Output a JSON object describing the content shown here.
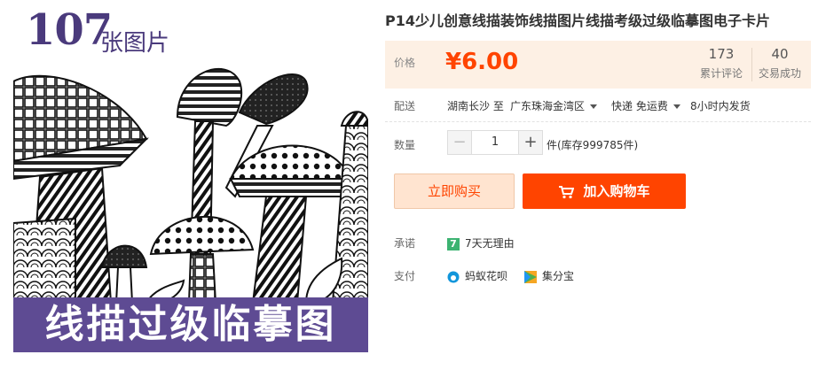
{
  "hero": {
    "count": "107",
    "count_unit": "张图片",
    "banner": "线描过级临摹图"
  },
  "product": {
    "title": "P14少儿创意线描装饰线描图片线描考级过级临摹图电子卡片"
  },
  "price": {
    "label": "价格",
    "value": "¥6.00",
    "reviews_count": "173",
    "reviews_label": "累计评论",
    "sales_count": "40",
    "sales_label": "交易成功"
  },
  "shipping": {
    "label": "配送",
    "from": "湖南长沙 至",
    "to": "广东珠海金湾区",
    "method": "快递 免运费",
    "dispatch": "8小时内发货"
  },
  "quantity": {
    "label": "数量",
    "minus": "−",
    "value": "1",
    "plus": "+",
    "stock": "件(库存999785件)"
  },
  "actions": {
    "buy_now": "立即购买",
    "add_to_cart": "加入购物车"
  },
  "promise": {
    "label": "承诺",
    "text": "7天无理由"
  },
  "payment": {
    "label": "支付",
    "method1": "蚂蚁花呗",
    "method2": "集分宝"
  },
  "colors": {
    "accent": "#ff4400",
    "price_bg": "#fdf0e4",
    "brand_purple": "#5e4b93"
  }
}
